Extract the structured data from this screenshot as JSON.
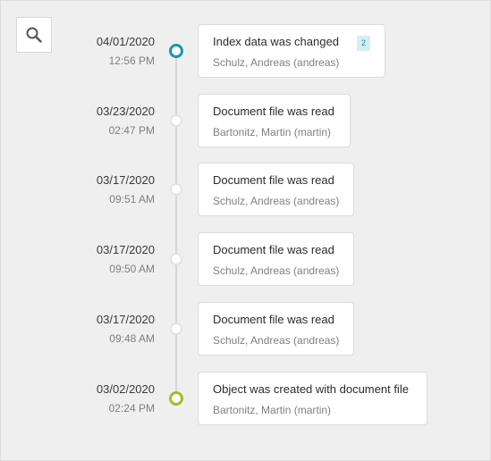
{
  "colors": {
    "active_dot": "#1c96a8",
    "created_dot": "#9fbf2a",
    "badge_bg": "#d4eef3",
    "badge_text": "#1c8fa3"
  },
  "search": {
    "icon": "search-icon"
  },
  "entries": [
    {
      "date": "04/01/2020",
      "time": "12:56 PM",
      "title": "Index data was changed",
      "user": "Schulz, Andreas (andreas)",
      "badge": "2",
      "state": "active"
    },
    {
      "date": "03/23/2020",
      "time": "02:47 PM",
      "title": "Document file was read",
      "user": "Bartonitz, Martin (martin)",
      "badge": "",
      "state": "normal"
    },
    {
      "date": "03/17/2020",
      "time": "09:51 AM",
      "title": "Document file was read",
      "user": "Schulz, Andreas (andreas)",
      "badge": "",
      "state": "normal"
    },
    {
      "date": "03/17/2020",
      "time": "09:50 AM",
      "title": "Document file was read",
      "user": "Schulz, Andreas (andreas)",
      "badge": "",
      "state": "normal"
    },
    {
      "date": "03/17/2020",
      "time": "09:48 AM",
      "title": "Document file was read",
      "user": "Schulz, Andreas (andreas)",
      "badge": "",
      "state": "normal"
    },
    {
      "date": "03/02/2020",
      "time": "02:24 PM",
      "title": "Object was created with document file",
      "user": "Bartonitz, Martin (martin)",
      "badge": "",
      "state": "created"
    }
  ]
}
